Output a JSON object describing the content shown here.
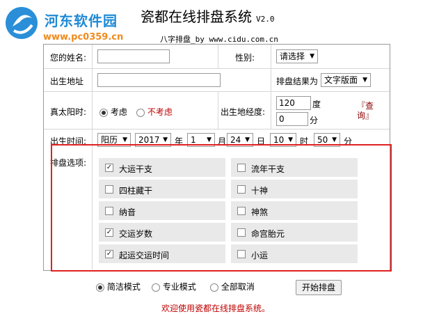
{
  "watermark": {
    "site": "河东软件园",
    "url": "www.pc0359.cn"
  },
  "header": {
    "title": "瓷都在线排盘系统",
    "version": "V2.0",
    "subtitle": "八字排盘_by www.cidu.com.cn"
  },
  "form": {
    "name_label": "您的姓名:",
    "gender_label": "性别:",
    "gender_value": "请选择",
    "birthplace_label": "出生地址",
    "result_label": "排盘结果为",
    "result_value": "文字版面",
    "solar_label": "真太阳时:",
    "solar_opt1": "考虑",
    "solar_opt2": "不考虑",
    "longitude_label": "出生地经度:",
    "lon_deg_value": "120",
    "lon_deg_unit": "度",
    "lon_min_value": "0",
    "lon_min_unit": "分",
    "lookup_link": "『查询』",
    "time_label": "出生时间:",
    "calendar_value": "阳历",
    "year_value": "2017",
    "year_unit": "年",
    "month_value": "1",
    "month_unit": "月",
    "day_value": "24",
    "day_unit": "日",
    "hour_value": "10",
    "hour_unit": "时",
    "minute_value": "50",
    "minute_unit": "分",
    "options_label": "排盘选项:"
  },
  "options": [
    {
      "label": "大运干支",
      "checked": true
    },
    {
      "label": "流年干支",
      "checked": false
    },
    {
      "label": "四柱藏干",
      "checked": false
    },
    {
      "label": "十神",
      "checked": false
    },
    {
      "label": "纳音",
      "checked": false
    },
    {
      "label": "神煞",
      "checked": false
    },
    {
      "label": "交运岁数",
      "checked": true
    },
    {
      "label": "命宫胎元",
      "checked": false
    },
    {
      "label": "起运交运时间",
      "checked": true
    },
    {
      "label": "小运",
      "checked": false
    }
  ],
  "bottom": {
    "mode1": "简洁模式",
    "mode2": "专业模式",
    "mode3": "全部取消",
    "start_button": "开始排盘",
    "welcome": "欢迎使用瓷都在线排盘系统。"
  },
  "colors": {
    "watermark_blue": "#1e8ad6",
    "watermark_orange": "#f08a1c",
    "highlight_red": "#e02020",
    "welcome_red": "#c00000"
  }
}
